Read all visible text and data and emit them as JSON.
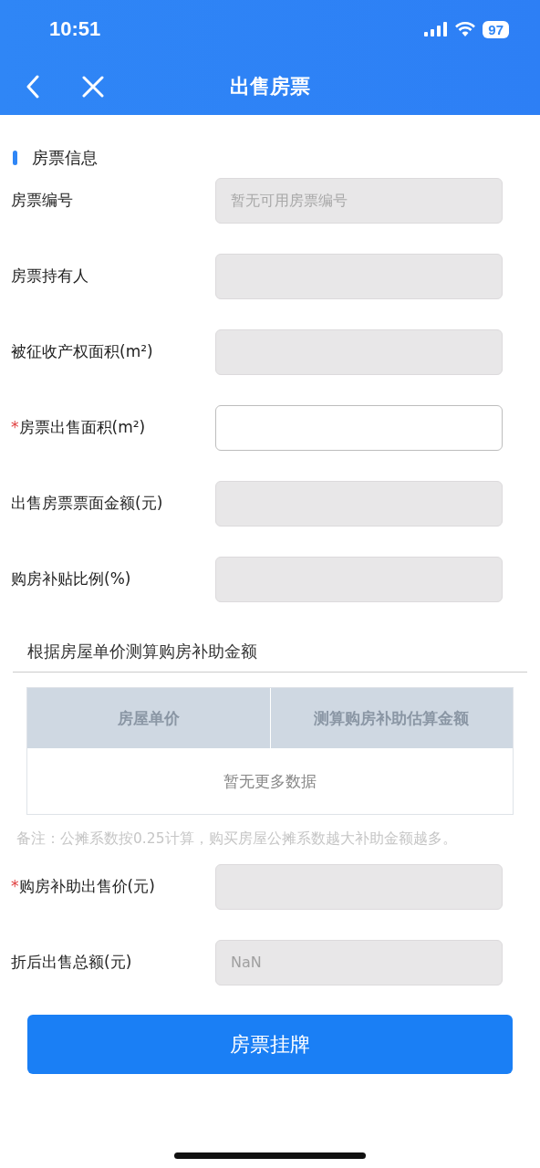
{
  "status_bar": {
    "time": "10:51",
    "battery": "97"
  },
  "nav": {
    "title": "出售房票"
  },
  "section": {
    "title": "房票信息"
  },
  "required_mark": "*",
  "fields": [
    {
      "label": "房票编号",
      "required": false,
      "disabled": true,
      "placeholder": "暂无可用房票编号"
    },
    {
      "label": "房票持有人",
      "required": false,
      "disabled": true
    },
    {
      "label": "被征收产权面积(m²)",
      "required": false,
      "disabled": true
    },
    {
      "label": "房票出售面积(m²)",
      "required": true,
      "disabled": false
    },
    {
      "label": "出售房票票面金额(元)",
      "required": false,
      "disabled": true
    },
    {
      "label": "购房补贴比例(%)",
      "required": false,
      "disabled": true
    }
  ],
  "calc": {
    "title": "根据房屋单价测算购房补助金额",
    "columns": [
      "房屋单价",
      "测算购房补助估算金额"
    ],
    "empty": "暂无更多数据",
    "note": "备注：公摊系数按0.25计算，购买房屋公摊系数越大补助金额越多。"
  },
  "fields_2": [
    {
      "label": "购房补助出售价(元)",
      "required": true,
      "disabled": true
    },
    {
      "label": "折后出售总额(元)",
      "required": false,
      "disabled": true,
      "value": "NaN"
    }
  ],
  "submit": "房票挂牌"
}
